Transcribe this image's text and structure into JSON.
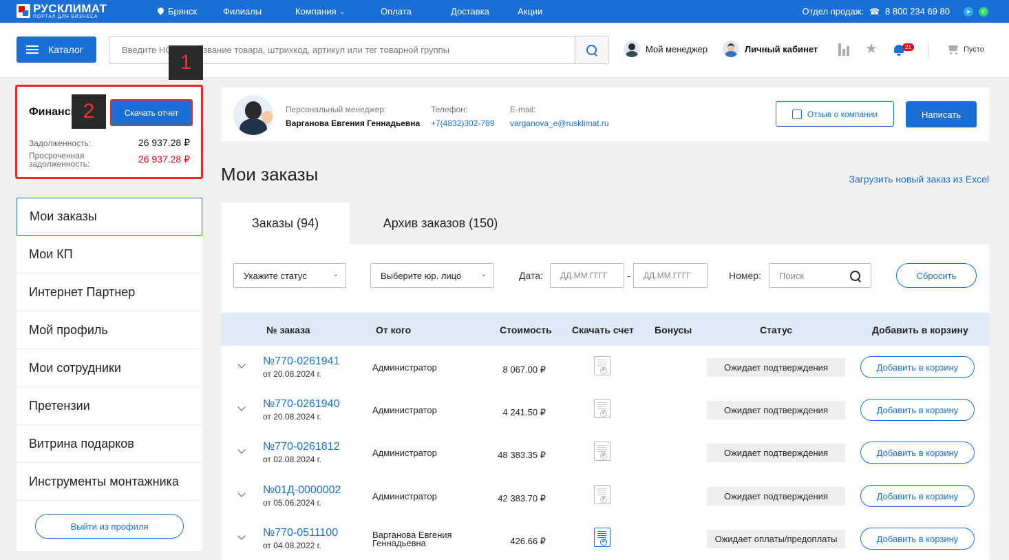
{
  "topbar": {
    "logo_name": "РУСКЛИМАТ",
    "logo_sub": "ПОРТАЛ ДЛЯ БИЗНЕСА",
    "city": "Брянск",
    "nav": [
      "Филиалы",
      "Компания",
      "Оплата",
      "Доставка",
      "Акции"
    ],
    "sales_label": "Отдел продаж:",
    "phone": "8 800 234 69 80"
  },
  "header": {
    "catalog_label": "Каталог",
    "search_placeholder": "Введите НС код, название товара, штрихкод, артикул или тег товарной группы",
    "manager_link": "Мой менеджер",
    "cabinet_link": "Личный кабинет",
    "notifications_count": "21",
    "cart_label": "Пусто"
  },
  "overlays": {
    "one": "1",
    "two": "2"
  },
  "finance": {
    "title": "Финансы",
    "download_label": "Скачать отчет",
    "debt_label": "Задолженность:",
    "debt_value": "26 937.28 ₽",
    "overdue_label_1": "Просроченная",
    "overdue_label_2": "задолженность:",
    "overdue_value": "26 937.28 ₽"
  },
  "sidebar": {
    "items": [
      {
        "label": "Мои заказы"
      },
      {
        "label": "Мои КП"
      },
      {
        "label": "Интернет Партнер"
      },
      {
        "label": "Мой профиль"
      },
      {
        "label": "Мои сотрудники"
      },
      {
        "label": "Претензии"
      },
      {
        "label": "Витрина подарков"
      },
      {
        "label": "Инструменты монтажника"
      }
    ],
    "logout_label": "Выйти из профиля"
  },
  "manager": {
    "role_label": "Персональный менеджер:",
    "name": "Варганова Евгения Геннадьевна",
    "phone_label": "Телефон:",
    "phone": "+7(4832)302-789",
    "email_label": "E-mail:",
    "email": "varganova_e@rusklimat.ru",
    "review_label": "Отзыв о компании",
    "write_label": "Написать"
  },
  "page": {
    "title": "Мои заказы",
    "excel_link": "Загрузить новый заказ из Excel"
  },
  "tabs": [
    {
      "label": "Заказы (94)"
    },
    {
      "label": "Архив заказов (150)"
    }
  ],
  "filters": {
    "status_placeholder": "Укажите статус",
    "entity_placeholder": "Выберите юр. лицо",
    "date_label": "Дата:",
    "date_from": "ДД.ММ.ГГГГ",
    "date_sep": "-",
    "date_to": "ДД.ММ.ГГГГ",
    "number_label": "Номер:",
    "number_placeholder": "Поиск",
    "reset_label": "Сбросить"
  },
  "table": {
    "columns": [
      "№ заказа",
      "От кого",
      "Стоимость",
      "Скачать счет",
      "Бонусы",
      "Статус",
      "Добавить в корзину"
    ],
    "add_label": "Добавить в корзину",
    "rows": [
      {
        "number": "№770-0261941",
        "date": "от 20.08.2024 г.",
        "from": "Администратор",
        "from2": "",
        "cost": "8 067.00 ₽",
        "status": "Ожидает подтверждения"
      },
      {
        "number": "№770-0261940",
        "date": "от 20.08.2024 г.",
        "from": "Администратор",
        "from2": "",
        "cost": "4 241.50 ₽",
        "status": "Ожидает подтверждения"
      },
      {
        "number": "№770-0261812",
        "date": "от 02.08.2024 г.",
        "from": "Администратор",
        "from2": "",
        "cost": "48 383.35 ₽",
        "status": "Ожидает подтверждения"
      },
      {
        "number": "№01Д-0000002",
        "date": "от 05.06.2024 г.",
        "from": "Администратор",
        "from2": "",
        "cost": "42 383.70 ₽",
        "status": "Ожидает подтверждения"
      },
      {
        "number": "№770-0511100",
        "date": "от 04.08.2022 г.",
        "from": "Варганова Евгения",
        "from2": "Геннадьевна",
        "cost": "426.66 ₽",
        "status": "Ожидает оплаты/предоплаты"
      }
    ]
  },
  "colors": {
    "brand": "#1a6fd6",
    "highlight": "#e82a2a",
    "overdue": "#e30613"
  }
}
